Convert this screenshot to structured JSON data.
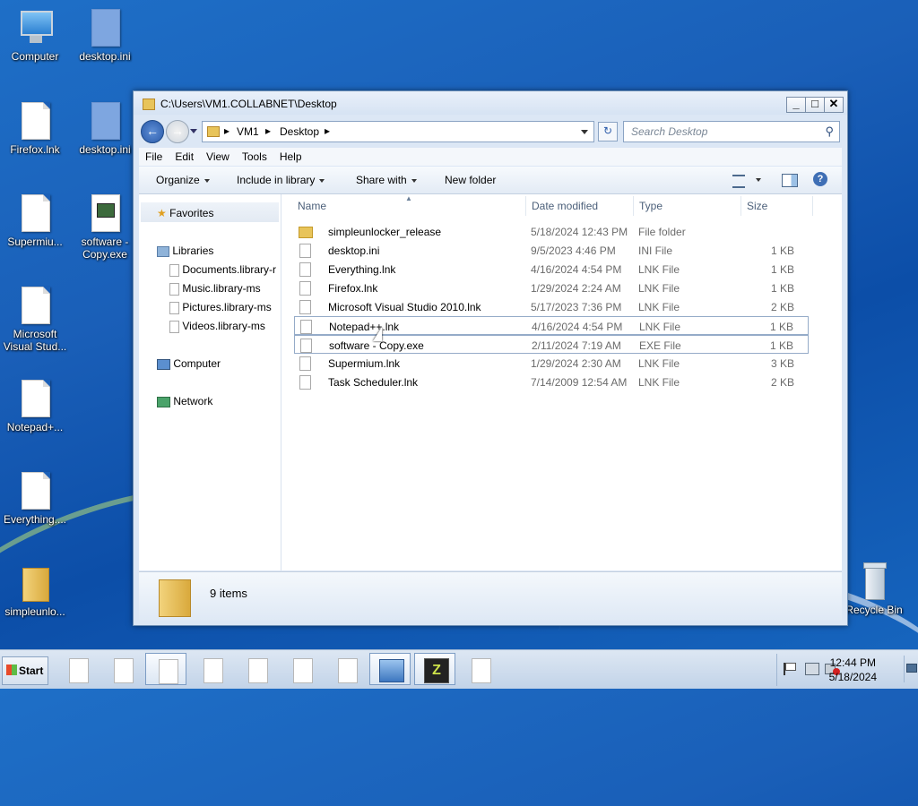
{
  "desktop": {
    "icons": [
      {
        "label": "Computer",
        "icon": "computer-icon"
      },
      {
        "label": "desktop.ini",
        "icon": "file-icon"
      },
      {
        "label": "Firefox.lnk",
        "icon": "file-icon"
      },
      {
        "label": "desktop.ini",
        "icon": "file-icon"
      },
      {
        "label": "Supermiu...",
        "icon": "file-icon"
      },
      {
        "label": "software - Copy.exe",
        "icon": "exe-icon"
      },
      {
        "label": "Microsoft Visual Stud...",
        "icon": "file-icon"
      },
      {
        "label": "Notepad+...",
        "icon": "file-icon"
      },
      {
        "label": "Everything....",
        "icon": "file-icon"
      },
      {
        "label": "simpleunlo...",
        "icon": "folder-icon"
      },
      {
        "label": "Recycle Bin",
        "icon": "recycle-bin-icon"
      }
    ]
  },
  "window": {
    "title": "C:\\Users\\VM1.COLLABNET\\Desktop",
    "controls": {
      "minimize": "_",
      "maximize": "□",
      "close": "✕"
    },
    "address": {
      "segments": [
        "VM1",
        "Desktop"
      ]
    },
    "search": {
      "placeholder": "Search Desktop"
    },
    "menu": [
      "File",
      "Edit",
      "View",
      "Tools",
      "Help"
    ],
    "toolbar": {
      "organize": "Organize",
      "include_in_library": "Include in library",
      "share_with": "Share with",
      "new_folder": "New folder"
    },
    "nav": {
      "favorites": "Favorites",
      "libraries": "Libraries",
      "library_items": [
        "Documents.library-r",
        "Music.library-ms",
        "Pictures.library-ms",
        "Videos.library-ms"
      ],
      "computer": "Computer",
      "network": "Network"
    },
    "columns": {
      "name": "Name",
      "date": "Date modified",
      "type": "Type",
      "size": "Size"
    },
    "files": [
      {
        "name": "simpleunlocker_release",
        "date": "5/18/2024 12:43 PM",
        "type": "File folder",
        "size": "",
        "kind": "folder"
      },
      {
        "name": "desktop.ini",
        "date": "9/5/2023 4:46 PM",
        "type": "INI File",
        "size": "1 KB",
        "kind": "file"
      },
      {
        "name": "Everything.lnk",
        "date": "4/16/2024 4:54 PM",
        "type": "LNK File",
        "size": "1 KB",
        "kind": "file"
      },
      {
        "name": "Firefox.lnk",
        "date": "1/29/2024 2:24 AM",
        "type": "LNK File",
        "size": "1 KB",
        "kind": "file"
      },
      {
        "name": "Microsoft Visual Studio 2010.lnk",
        "date": "5/17/2023 7:36 PM",
        "type": "LNK File",
        "size": "2 KB",
        "kind": "file"
      },
      {
        "name": "Notepad++.lnk",
        "date": "4/16/2024 4:54 PM",
        "type": "LNK File",
        "size": "1 KB",
        "kind": "file"
      },
      {
        "name": "software - Copy.exe",
        "date": "2/11/2024 7:19 AM",
        "type": "EXE File",
        "size": "1 KB",
        "kind": "exe"
      },
      {
        "name": "Supermium.lnk",
        "date": "1/29/2024 2:30 AM",
        "type": "LNK File",
        "size": "3 KB",
        "kind": "file"
      },
      {
        "name": "Task Scheduler.lnk",
        "date": "7/14/2009 12:54 AM",
        "type": "LNK File",
        "size": "2 KB",
        "kind": "file"
      }
    ],
    "status": {
      "item_count": "9 items"
    }
  },
  "taskbar": {
    "start_label": "Start",
    "time": "12:44 PM",
    "date": "5/18/2024"
  }
}
